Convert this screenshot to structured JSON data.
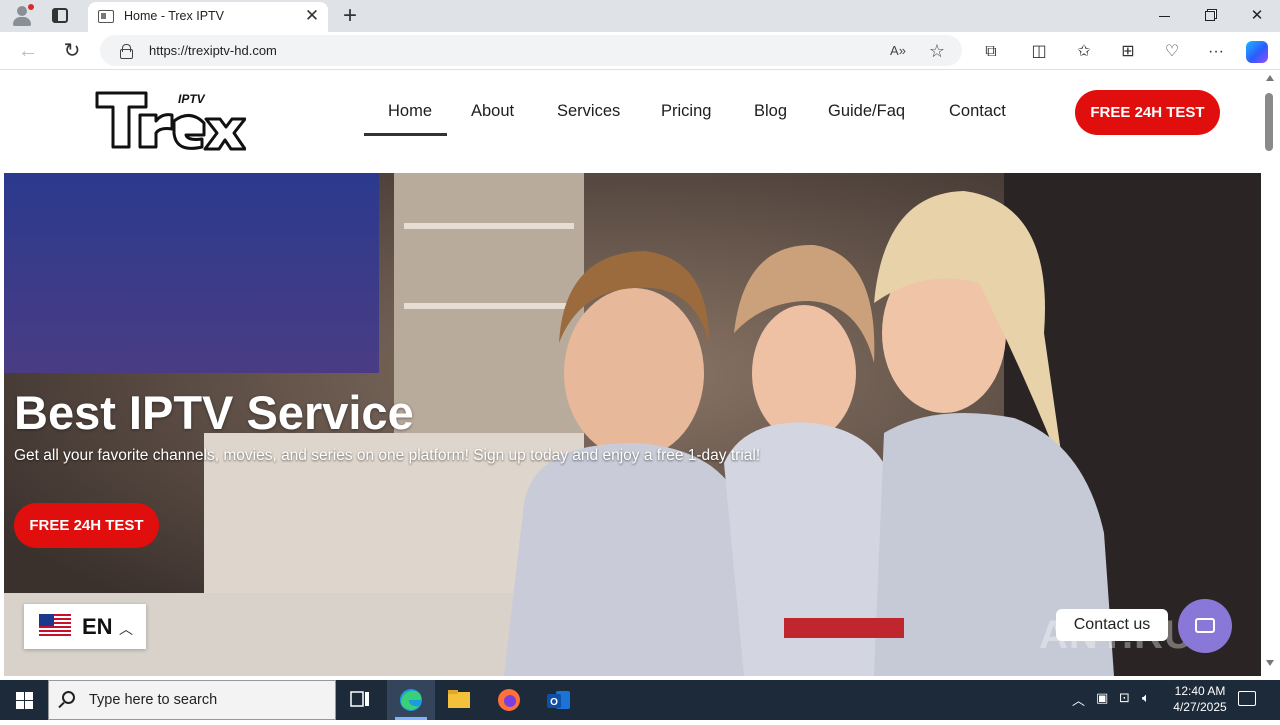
{
  "browser": {
    "tab_title": "Home - Trex IPTV",
    "url": "https://trexiptv-hd.com",
    "icons": [
      "profile-icon",
      "tab-actions-icon",
      "new-tab-icon",
      "back-icon",
      "reload-icon",
      "lock-icon",
      "read-aloud-icon",
      "favorite-icon",
      "extensions-icon",
      "split-screen-icon",
      "favorites-icon",
      "collections-icon",
      "browser-essentials-icon",
      "more-icon",
      "copilot-icon"
    ]
  },
  "site": {
    "logo": {
      "main": "Trex",
      "tag": "IPTV"
    },
    "nav": [
      {
        "label": "Home",
        "active": true
      },
      {
        "label": "About"
      },
      {
        "label": "Services"
      },
      {
        "label": "Pricing"
      },
      {
        "label": "Blog"
      },
      {
        "label": "Guide/Faq"
      },
      {
        "label": "Contact"
      }
    ],
    "header_cta": "FREE 24H TEST",
    "hero": {
      "title": "Best IPTV Service",
      "subtitle": "Get all your favorite channels, movies, and series on one platform! Sign up today and enjoy a free 1-day trial!",
      "cta": "FREE 24H TEST"
    },
    "language": {
      "code": "EN"
    },
    "contact": {
      "label": "Contact us"
    },
    "watermark": "ANY.RUN",
    "colors": {
      "accent": "#e10e0e",
      "chat": "#8a78d8"
    }
  },
  "taskbar": {
    "search_placeholder": "Type here to search",
    "time": "12:40 AM",
    "date": "4/27/2025"
  }
}
